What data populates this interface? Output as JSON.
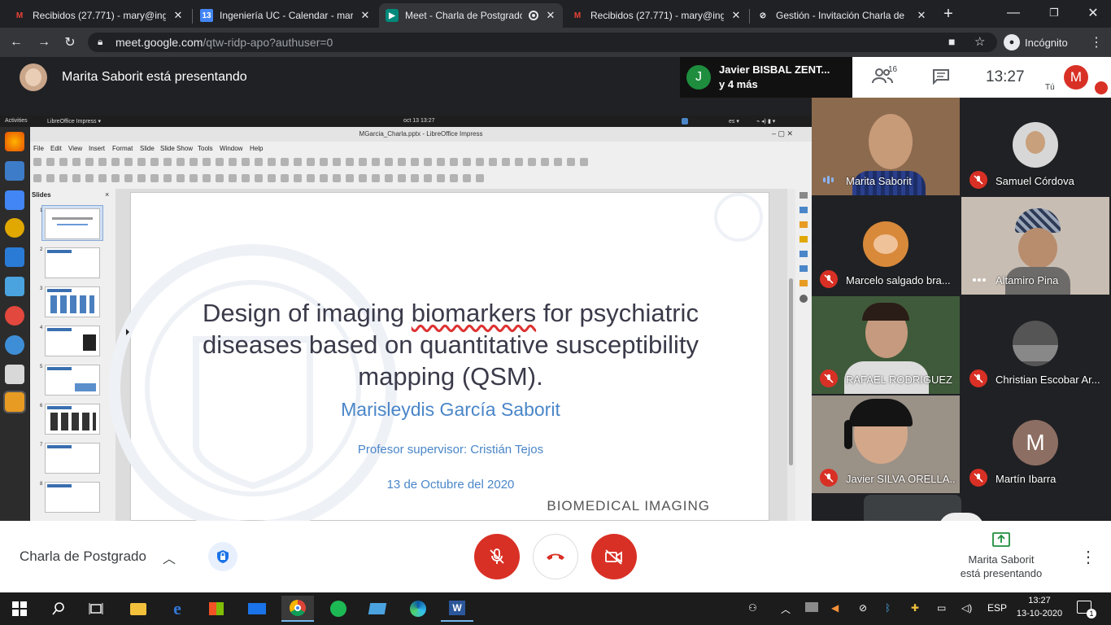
{
  "browser": {
    "tabs": [
      {
        "title": "Recibidos (27.771) - mary@ing",
        "favicon": "gmail-icon",
        "active": false
      },
      {
        "title": "Ingeniería UC - Calendar - mar",
        "favicon": "calendar-icon",
        "favicon_text": "13",
        "active": false
      },
      {
        "title": "Meet - Charla de Postgrado",
        "favicon": "meet-icon",
        "active": true
      },
      {
        "title": "Recibidos (27.771) - mary@ing",
        "favicon": "gmail-icon",
        "active": false
      },
      {
        "title": "Gestión - Invitación Charla de",
        "favicon": "link-icon",
        "active": false
      }
    ],
    "new_tab": "+",
    "url_host": "meet.google.com",
    "url_path": "/qtw-ridp-apo?authuser=0",
    "incognito_label": "Incógnito"
  },
  "meet": {
    "presenter_banner": "Marita Saborit está presentando",
    "top_speaker": {
      "initial": "J",
      "name": "Javier BISBAL ZENT...",
      "more": "y 4 más"
    },
    "participant_count": "16",
    "clock": "13:27",
    "self_initial": "M",
    "self_label": "Tú",
    "meeting_name": "Charla de Postgrado",
    "presenting_line1": "Marita Saborit",
    "presenting_line2": "está presentando",
    "participants": [
      {
        "name": "Marita Saborit",
        "muted": false,
        "speaking": true
      },
      {
        "name": "Samuel Córdova",
        "muted": true
      },
      {
        "name": "Marcelo salgado bra...",
        "muted": true
      },
      {
        "name": "Altamiro Pina",
        "muted": false,
        "speaking": true
      },
      {
        "name": "RAFAEL RODRIGUEZ ...",
        "muted": true
      },
      {
        "name": "Christian Escobar Ar...",
        "muted": true
      },
      {
        "name": "Javier SILVA ORELLA...",
        "muted": true
      },
      {
        "name": "Martín Ibarra",
        "muted": true,
        "initial": "M"
      }
    ]
  },
  "libreoffice": {
    "gnome_activities": "Activities",
    "gnome_app": "LibreOffice Impress ▾",
    "gnome_clock": "oct 13  13:27",
    "gnome_lang": "es ▾",
    "window_title": "MGarcia_Charla.pptx - LibreOffice Impress",
    "menu": [
      "File",
      "Edit",
      "View",
      "Insert",
      "Format",
      "Slide",
      "Slide Show",
      "Tools",
      "Window",
      "Help"
    ],
    "slides_label": "Slides",
    "slides_close": "×",
    "thumbnails": [
      "1",
      "2",
      "3",
      "4",
      "5",
      "6",
      "7",
      "8"
    ],
    "slide": {
      "title_part1": "Design of imaging ",
      "title_underlined": "biomarkers",
      "title_part2": " for psychiatric diseases based on quantitative susceptibility mapping (QSM).",
      "author": "Marisleydis García Saborit",
      "supervisor": "Profesor supervisor: Cristián Tejos",
      "date": "13 de Octubre del 2020",
      "footer": "BIOMEDICAL IMAGING"
    }
  },
  "taskbar": {
    "lang": "ESP",
    "time": "13:27",
    "date": "13-10-2020",
    "notifications": "1"
  },
  "colors": {
    "meet_red": "#d93025",
    "accent_blue": "#4a86c8",
    "meet_green": "#1e8e3e"
  }
}
